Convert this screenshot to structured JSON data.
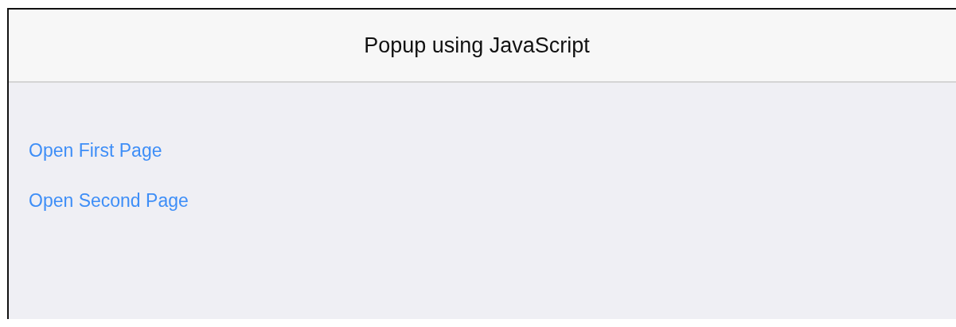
{
  "header": {
    "title": "Popup using JavaScript"
  },
  "links": [
    "Open First Page",
    "Open Second Page"
  ]
}
